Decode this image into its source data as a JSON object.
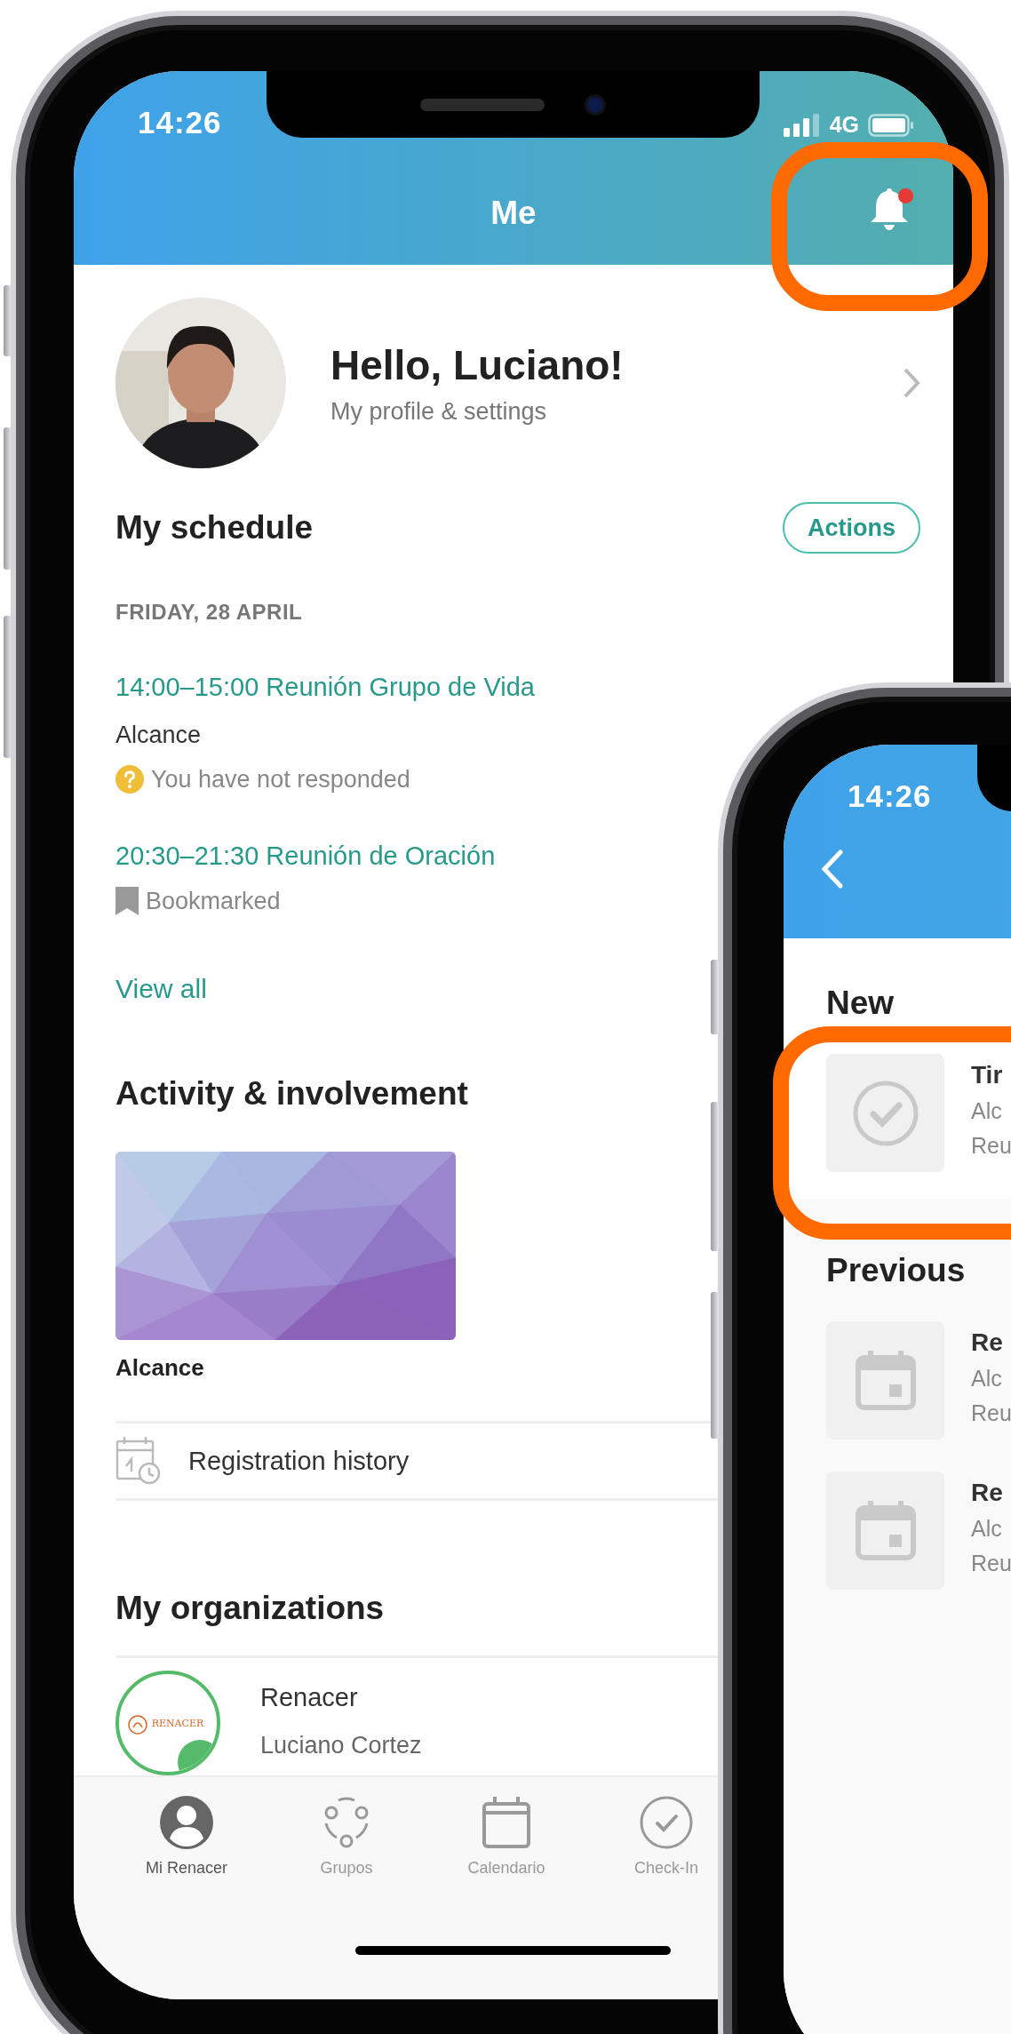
{
  "main_phone": {
    "status_bar": {
      "time": "14:26",
      "network": "4G"
    },
    "header": {
      "title": "Me",
      "notification_dot": true,
      "highlighted": true
    },
    "profile": {
      "greeting": "Hello, Luciano!",
      "subtitle": "My profile & settings"
    },
    "schedule": {
      "title": "My schedule",
      "action_button": "Actions",
      "date": "FRIDAY, 28 APRIL",
      "events": [
        {
          "title": "14:00–15:00 Reunión Grupo de Vida",
          "location": "Alcance",
          "status": {
            "kind": "unanswered",
            "text": "You have not responded"
          }
        },
        {
          "title": "20:30–21:30 Reunión de Oración",
          "status": {
            "kind": "bookmarked",
            "text": "Bookmarked"
          }
        }
      ],
      "view_all": "View all"
    },
    "activity": {
      "title": "Activity & involvement",
      "cards": [
        {
          "kind": "picture",
          "label": "Alcance"
        }
      ],
      "links": [
        {
          "label": "Registration history"
        }
      ]
    },
    "organizations": {
      "title": "My organizations",
      "items": [
        {
          "name": "Renacer",
          "member": "Luciano Cortez",
          "logo_text": "RENACER"
        }
      ]
    },
    "tab_bar": [
      {
        "label": "Mi Renacer",
        "kind": "user",
        "selected": true
      },
      {
        "label": "Grupos",
        "kind": "groups",
        "selected": false
      },
      {
        "label": "Calendario",
        "kind": "calendar",
        "selected": false
      },
      {
        "label": "Check-In",
        "kind": "check",
        "selected": false
      }
    ]
  },
  "notifications_phone": {
    "status_bar": {
      "time": "14:26"
    },
    "sections": [
      {
        "title": "New",
        "highlighted": true,
        "items": [
          {
            "kind": "check",
            "title": "Tir",
            "line_1": "Alc",
            "line_2": "Reu"
          }
        ]
      },
      {
        "title": "Previous",
        "highlighted": false,
        "items": [
          {
            "kind": "calendar",
            "title": "Re",
            "line_1": "Alc",
            "line_2": "Reu"
          },
          {
            "kind": "calendar",
            "title": "Re",
            "line_1": "Alc",
            "line_2": "Reu"
          }
        ]
      }
    ]
  }
}
